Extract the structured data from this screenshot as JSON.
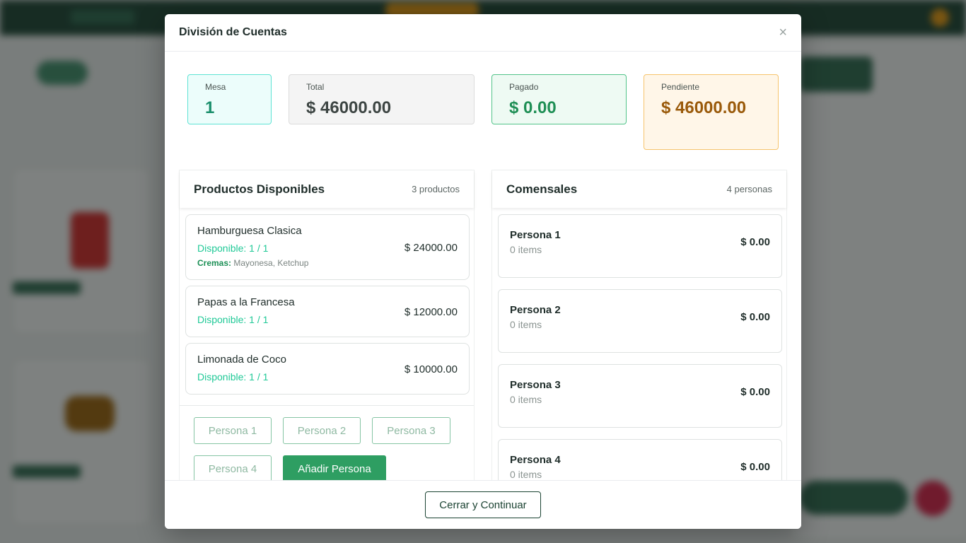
{
  "modal": {
    "title": "División de Cuentas",
    "close_symbol": "×"
  },
  "summary": {
    "mesa_label": "Mesa",
    "mesa_value": "1",
    "total_label": "Total",
    "total_value": "$ 46000.00",
    "pagado_label": "Pagado",
    "pagado_value": "$ 0.00",
    "pendiente_label": "Pendiente",
    "pendiente_value": "$ 46000.00"
  },
  "products_panel": {
    "title": "Productos Disponibles",
    "count": "3 productos",
    "items": [
      {
        "name": "Hamburguesa Clasica",
        "available": "Disponible: 1 / 1",
        "extras_label": "Cremas:",
        "extras_value": " Mayonesa, Ketchup",
        "price": "$ 24000.00"
      },
      {
        "name": "Papas a la Francesa",
        "available": "Disponible: 1 / 1",
        "price": "$ 12000.00"
      },
      {
        "name": "Limonada de Coco",
        "available": "Disponible: 1 / 1",
        "price": "$ 10000.00"
      }
    ],
    "person_buttons": [
      "Persona 1",
      "Persona 2",
      "Persona 3",
      "Persona 4"
    ],
    "add_person_label": "Añadir Persona"
  },
  "diners_panel": {
    "title": "Comensales",
    "count": "4 personas",
    "diners": [
      {
        "name": "Persona 1",
        "items": "0 items",
        "amount": "$ 0.00"
      },
      {
        "name": "Persona 2",
        "items": "0 items",
        "amount": "$ 0.00"
      },
      {
        "name": "Persona 3",
        "items": "0 items",
        "amount": "$ 0.00"
      },
      {
        "name": "Persona 4",
        "items": "0 items",
        "amount": "$ 0.00"
      }
    ]
  },
  "footer": {
    "close_continue_label": "Cerrar y Continuar"
  },
  "colors": {
    "primary_green": "#2e9e62",
    "dark_green": "#1b4332",
    "available_teal": "#20c997",
    "pending_amber": "#9a5a0a"
  }
}
